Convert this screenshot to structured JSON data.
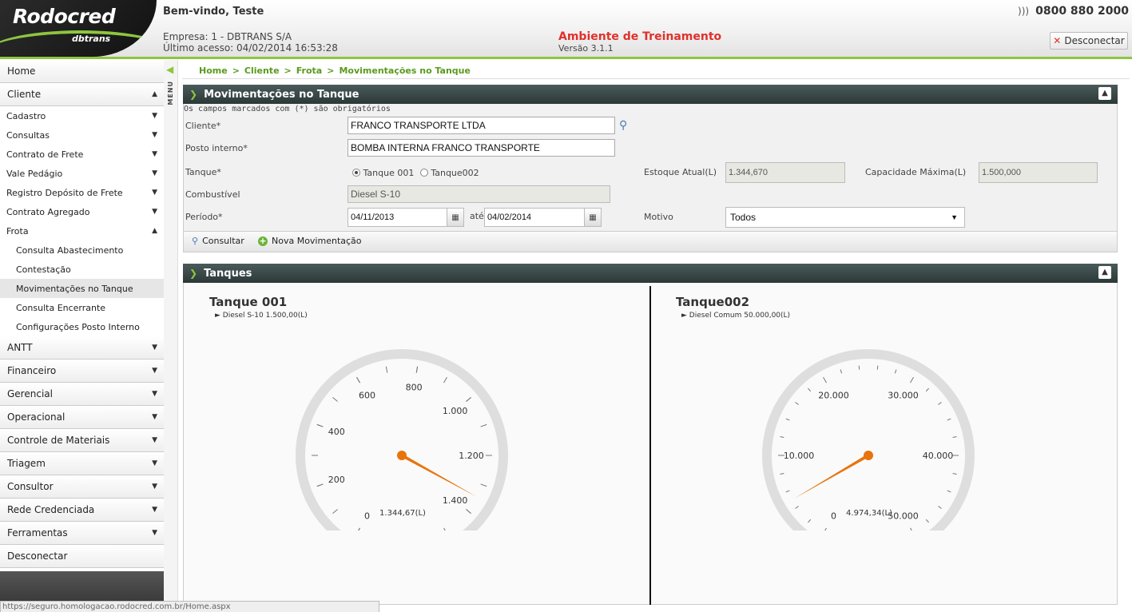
{
  "header": {
    "logo_main": "Rodocred",
    "logo_sub": "dbtrans",
    "welcome": "Bem-vindo, Teste",
    "empresa": "Empresa: 1 - DBTRANS S/A",
    "ultimo_acesso": "Último acesso: 04/02/2014 16:53:28",
    "ambiente": "Ambiente de Treinamento",
    "versao": "Versão 3.1.1",
    "phone": "0800 880 2000",
    "logout_label": "Desconectar"
  },
  "sidebar": {
    "home": "Home",
    "cliente": "Cliente",
    "cliente_items": [
      "Cadastro",
      "Consultas",
      "Contrato de Frete",
      "Vale Pedágio",
      "Registro Depósito de Frete",
      "Contrato Agregado",
      "Frota"
    ],
    "frota_items": [
      "Consulta Abastecimento",
      "Contestação",
      "Movimentações no Tanque",
      "Consulta Encerrante",
      "Configurações Posto Interno"
    ],
    "sections": [
      "ANTT",
      "Financeiro",
      "Gerencial",
      "Operacional",
      "Controle de Materiais",
      "Triagem",
      "Consultor",
      "Rede Credenciada",
      "Ferramentas",
      "Desconectar"
    ],
    "menu_label": "MENU"
  },
  "breadcrumb": [
    "Home",
    "Cliente",
    "Frota",
    "Movimentações no Tanque"
  ],
  "form_panel": {
    "title": "Movimentações no Tanque",
    "required_note": "Os campos marcados com (*) são obrigatórios",
    "cliente_label": "Cliente*",
    "cliente_value": "FRANCO TRANSPORTE LTDA",
    "posto_label": "Posto interno*",
    "posto_value": "BOMBA INTERNA FRANCO TRANSPORTE",
    "tanque_label": "Tanque*",
    "tanque_options": [
      "Tanque 001",
      "Tanque002"
    ],
    "estoque_label": "Estoque Atual(L)",
    "estoque_value": "1.344,670",
    "capacidade_label": "Capacidade Máxima(L)",
    "capacidade_value": "1.500,000",
    "combustivel_label": "Combustível",
    "combustivel_value": "Diesel S-10",
    "periodo_label": "Período*",
    "periodo_inicio": "04/11/2013",
    "ate": "até",
    "periodo_fim": "04/02/2014",
    "motivo_label": "Motivo",
    "motivo_value": "Todos",
    "btn_consultar": "Consultar",
    "btn_nova": "Nova Movimentação"
  },
  "tanques_panel": {
    "title": "Tanques",
    "tanks": [
      {
        "name": "Tanque 001",
        "fuel": "► Diesel S-10 1.500,00(L)",
        "value_label": "1.344,67(L)",
        "value": 1344.67,
        "max": 1500,
        "ticks": [
          "0",
          "200",
          "400",
          "600",
          "800",
          "1.000",
          "1.200",
          "1.400"
        ]
      },
      {
        "name": "Tanque002",
        "fuel": "► Diesel Comum 50.000,00(L)",
        "value_label": "4.974,34(L)",
        "value": 4974.34,
        "max": 50000,
        "ticks": [
          "0",
          "10.000",
          "20.000",
          "30.000",
          "40.000",
          "50.000"
        ]
      }
    ]
  },
  "status_bar": "https://seguro.homologacao.rodocred.com.br/Home.aspx",
  "colors": {
    "accent": "#8dc63f",
    "alert": "#e0312b",
    "needle": "#e8740c",
    "panel_header": "#2c3838"
  }
}
